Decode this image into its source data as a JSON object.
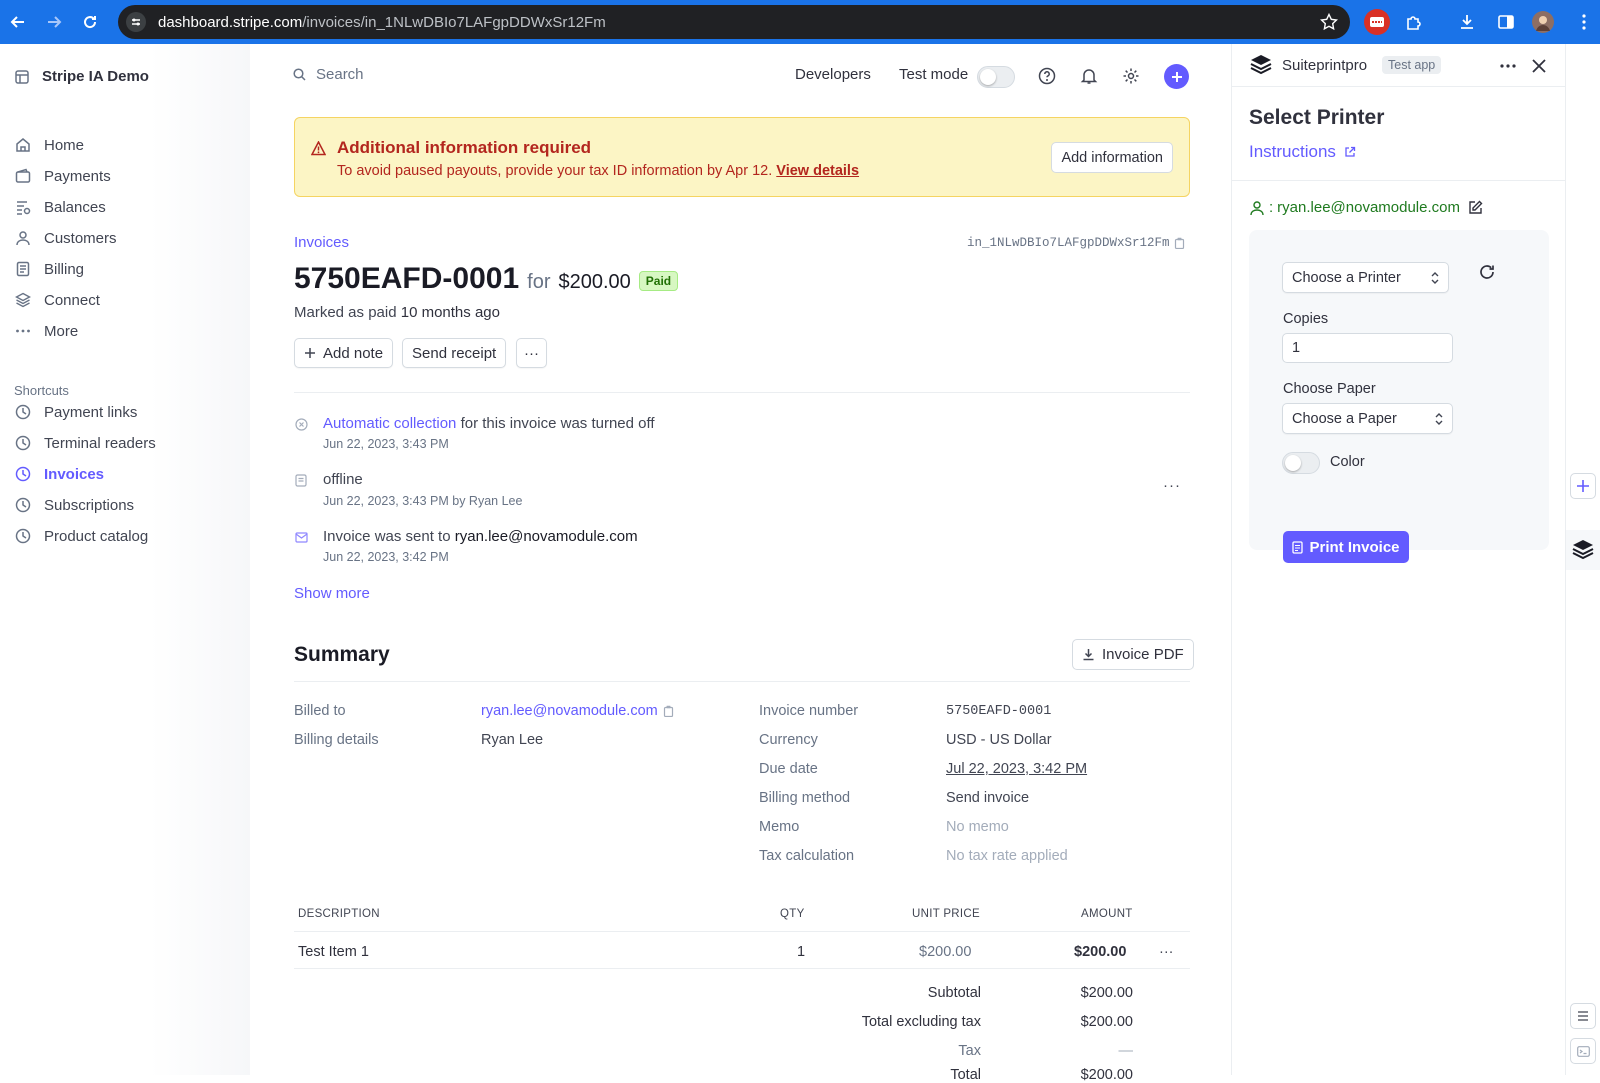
{
  "browser": {
    "url_host": "dashboard.stripe.com",
    "url_path": "/invoices/in_1NLwDBIo7LAFgpDDWxSr12Fm"
  },
  "sidebar": {
    "account_name": "Stripe IA Demo",
    "items": [
      {
        "label": "Home",
        "icon": "home-icon"
      },
      {
        "label": "Payments",
        "icon": "payments-icon"
      },
      {
        "label": "Balances",
        "icon": "balances-icon"
      },
      {
        "label": "Customers",
        "icon": "customers-icon"
      },
      {
        "label": "Billing",
        "icon": "billing-icon"
      },
      {
        "label": "Connect",
        "icon": "connect-icon"
      },
      {
        "label": "More",
        "icon": "more-icon"
      }
    ],
    "shortcuts_label": "Shortcuts",
    "shortcuts": [
      {
        "label": "Payment links"
      },
      {
        "label": "Terminal readers"
      },
      {
        "label": "Invoices",
        "active": true
      },
      {
        "label": "Subscriptions"
      },
      {
        "label": "Product catalog"
      }
    ]
  },
  "topbar": {
    "search_placeholder": "Search",
    "developers": "Developers",
    "test_mode": "Test mode"
  },
  "banner": {
    "title": "Additional information required",
    "text": "To avoid paused payouts, provide your tax ID information by Apr 12.",
    "link": "View details",
    "button": "Add information"
  },
  "invoice": {
    "breadcrumb": "Invoices",
    "id": "in_1NLwDBIo7LAFgpDDWxSr12Fm",
    "number": "5750EAFD-0001",
    "for_text": "for",
    "amount": "$200.00",
    "status": "Paid",
    "marked_prefix": "Marked as paid",
    "marked_time": "10 months ago",
    "actions": {
      "add_note": "Add note",
      "send_receipt": "Send receipt",
      "more": "···"
    }
  },
  "timeline": [
    {
      "link": "Automatic collection",
      "text": "for this invoice was turned off",
      "time": "Jun 22, 2023, 3:43 PM"
    },
    {
      "text": "offline",
      "time": "Jun 22, 2023, 3:43 PM by Ryan Lee"
    },
    {
      "text": "Invoice was sent to",
      "email": "ryan.lee@novamodule.com",
      "time": "Jun 22, 2023, 3:42 PM"
    }
  ],
  "show_more": "Show more",
  "summary": {
    "title": "Summary",
    "pdf_button": "Invoice PDF",
    "left": [
      {
        "label": "Billed to",
        "value": "ryan.lee@novamodule.com"
      },
      {
        "label": "Billing details",
        "value": "Ryan Lee"
      }
    ],
    "right": [
      {
        "label": "Invoice number",
        "value": "5750EAFD-0001"
      },
      {
        "label": "Currency",
        "value": "USD - US Dollar"
      },
      {
        "label": "Due date",
        "value": "Jul 22, 2023, 3:42 PM"
      },
      {
        "label": "Billing method",
        "value": "Send invoice"
      },
      {
        "label": "Memo",
        "value": "No memo"
      },
      {
        "label": "Tax calculation",
        "value": "No tax rate applied"
      }
    ]
  },
  "line_items": {
    "headers": [
      "DESCRIPTION",
      "QTY",
      "UNIT PRICE",
      "AMOUNT"
    ],
    "rows": [
      {
        "description": "Test Item 1",
        "qty": "1",
        "unit_price": "$200.00",
        "amount": "$200.00"
      }
    ],
    "totals": [
      {
        "label": "Subtotal",
        "value": "$200.00"
      },
      {
        "label": "Total excluding tax",
        "value": "$200.00"
      },
      {
        "label": "Tax",
        "value": "—"
      },
      {
        "label": "Total",
        "value": "$200.00"
      }
    ]
  },
  "panel": {
    "app_name": "Suiteprintpro",
    "app_badge": "Test app",
    "title": "Select Printer",
    "instructions": "Instructions",
    "user_prefix": ":",
    "user_email": "ryan.lee@novamodule.com",
    "printer_select": "Choose a Printer",
    "copies_label": "Copies",
    "copies_value": "1",
    "paper_label": "Choose Paper",
    "paper_select": "Choose a Paper",
    "color_label": "Color",
    "print_button": "Print Invoice"
  },
  "colors": {
    "accent": "#635bff",
    "chrome": "#1a73e8",
    "banner_bg": "#fcf5c5",
    "banner_text": "#b3261e",
    "paid_bg": "#d7f7c2",
    "paid_text": "#217005"
  }
}
